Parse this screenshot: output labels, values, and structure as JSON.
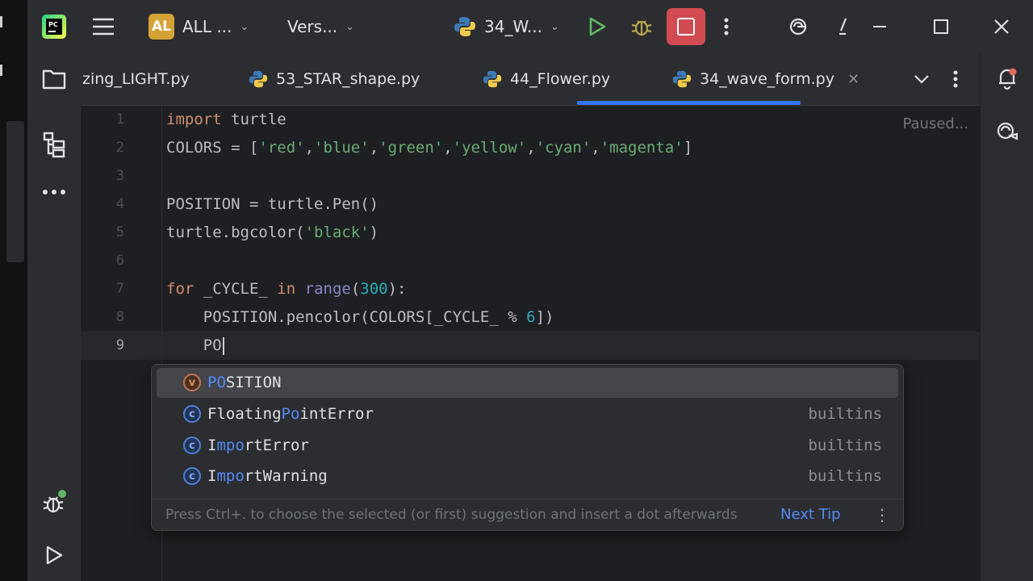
{
  "titlebar": {
    "project_badge": "AL",
    "project_name": "ALL ...",
    "vcs_label": "Vers...",
    "run_config": "34_W...",
    "colors": {
      "badge": "#d4a237",
      "run": "#5fb865",
      "debug": "#b6a648",
      "stop_bg": "#d24b52"
    }
  },
  "tabs": [
    {
      "label": "zing_LIGHT.py"
    },
    {
      "label": "53_STAR_shape.py"
    },
    {
      "label": "44_Flower.py"
    },
    {
      "label": "34_wave_form.py",
      "active": true
    }
  ],
  "editor": {
    "status": "Paused...",
    "line_numbers": [
      "1",
      "2",
      "3",
      "4",
      "5",
      "6",
      "7",
      "8",
      "9"
    ],
    "lines": {
      "l1": {
        "kw": "import",
        "rest": " turtle"
      },
      "l2": {
        "a": "COLORS = [",
        "s1": "'red'",
        "s2": "'blue'",
        "s3": "'green'",
        "s4": "'yellow'",
        "s5": "'cyan'",
        "s6": "'magenta'",
        "comma": ",",
        "end": "]"
      },
      "l4": {
        "text": "POSITION = turtle.Pen()"
      },
      "l5": {
        "a": "turtle.bgcolor(",
        "s": "'black'",
        "b": ")"
      },
      "l7": {
        "kw1": "for",
        "mid": " _CYCLE_ ",
        "kw2": "in",
        "sp": " ",
        "bi": "range",
        "op": "(",
        "num": "300",
        "end": "):"
      },
      "l8": {
        "a": "    POSITION.pencolor(COLORS[_CYCLE_ % ",
        "num": "6",
        "end": "])"
      },
      "l9": {
        "text": "    PO"
      }
    }
  },
  "completion": {
    "items": [
      {
        "icon": "v",
        "match": "PO",
        "rest": "SITION",
        "source": ""
      },
      {
        "icon": "c",
        "pre": "Floating",
        "match": "Po",
        "rest": "intError",
        "source": "builtins"
      },
      {
        "icon": "c",
        "pre": "I",
        "match": "mpo",
        "rest": "rtError",
        "source": "builtins"
      },
      {
        "icon": "c",
        "pre": "I",
        "match": "mpo",
        "rest": "rtWarning",
        "source": "builtins"
      }
    ],
    "hint": "Press Ctrl+. to choose the selected (or first) suggestion and insert a dot afterwards",
    "next_tip": "Next Tip"
  }
}
